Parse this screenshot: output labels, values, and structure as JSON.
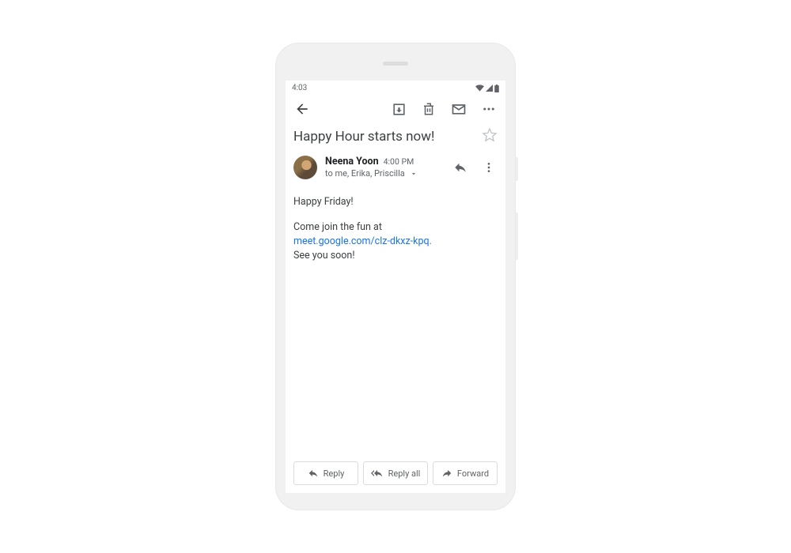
{
  "status": {
    "time": "4:03"
  },
  "email": {
    "subject": "Happy Hour starts now!",
    "sender": "Neena Yoon",
    "time": "4:00 PM",
    "recipients": "to me, Erika, Priscilla",
    "body": {
      "greeting": "Happy Friday!",
      "line1": "Come join the fun at ",
      "link": "meet.google.com/clz-dkxz-kpq.",
      "line2": "See you soon!"
    }
  },
  "actions": {
    "reply": "Reply",
    "replyAll": "Reply all",
    "forward": "Forward"
  }
}
